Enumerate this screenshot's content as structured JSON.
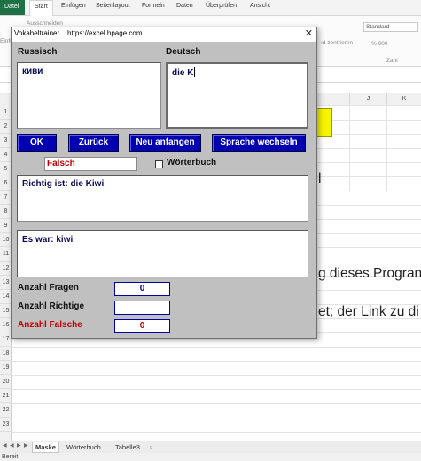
{
  "excel": {
    "ribbon_tabs": [
      {
        "label": "Datei"
      },
      {
        "label": "Start"
      },
      {
        "label": "Einfügen"
      },
      {
        "label": "Seitenlayout"
      },
      {
        "label": "Formeln"
      },
      {
        "label": "Daten"
      },
      {
        "label": "Überprüfen"
      },
      {
        "label": "Ansicht"
      }
    ],
    "ribbon": {
      "cut_label": "Ausschneiden",
      "paste_hint": "Einfü",
      "merge_center": "ıd zentrieren",
      "number_format": "Standard",
      "number_group": "Zahl",
      "currency_percent": "% 000"
    },
    "columns": [
      "I",
      "J",
      "K"
    ],
    "rows": [
      "1",
      "2",
      "3",
      "4",
      "5",
      "6",
      "7",
      "8",
      "9",
      "10",
      "11",
      "12",
      "13",
      "14",
      "15",
      "16",
      "17",
      "18",
      "19",
      "20",
      "21",
      "22",
      "23"
    ],
    "cell_text": [
      {
        "text": "l"
      },
      {
        "text": "g dieses Progran"
      },
      {
        "text": "et; der Link zu di"
      }
    ],
    "sheet_tabs": [
      {
        "label": "Maske",
        "active": true
      },
      {
        "label": "Wörterbuch",
        "active": false
      },
      {
        "label": "Tabelle3",
        "active": false
      }
    ],
    "status": "Bereit"
  },
  "dialog": {
    "title": "Vokabeltrainer",
    "url": "https://excel.hpage.com",
    "close_symbol": "✕",
    "source_lang": "Russisch",
    "target_lang": "Deutsch",
    "source_word": "киви",
    "answer_input": "die K",
    "buttons": {
      "ok": "OK",
      "back": "Zurück",
      "restart": "Neu anfangen",
      "switch_lang": "Sprache wechseln"
    },
    "result": "Falsch",
    "dictionary_label": "Wörterbuch",
    "dictionary_checked": false,
    "correct_text": "Richtig ist: die Kiwi",
    "previous_text": "Es war: kiwi",
    "stats": {
      "questions_label": "Anzahl Fragen",
      "questions_value": "0",
      "correct_label": "Anzahl Richtige",
      "correct_value": "",
      "wrong_label": "Anzahl Falsche",
      "wrong_value": "0"
    }
  },
  "colors": {
    "button_blue": "#0000b0",
    "dialog_gray": "#c0c0c0",
    "error_red": "#c00000",
    "excel_green": "#1e7145",
    "cell_yellow": "#f5f500"
  }
}
